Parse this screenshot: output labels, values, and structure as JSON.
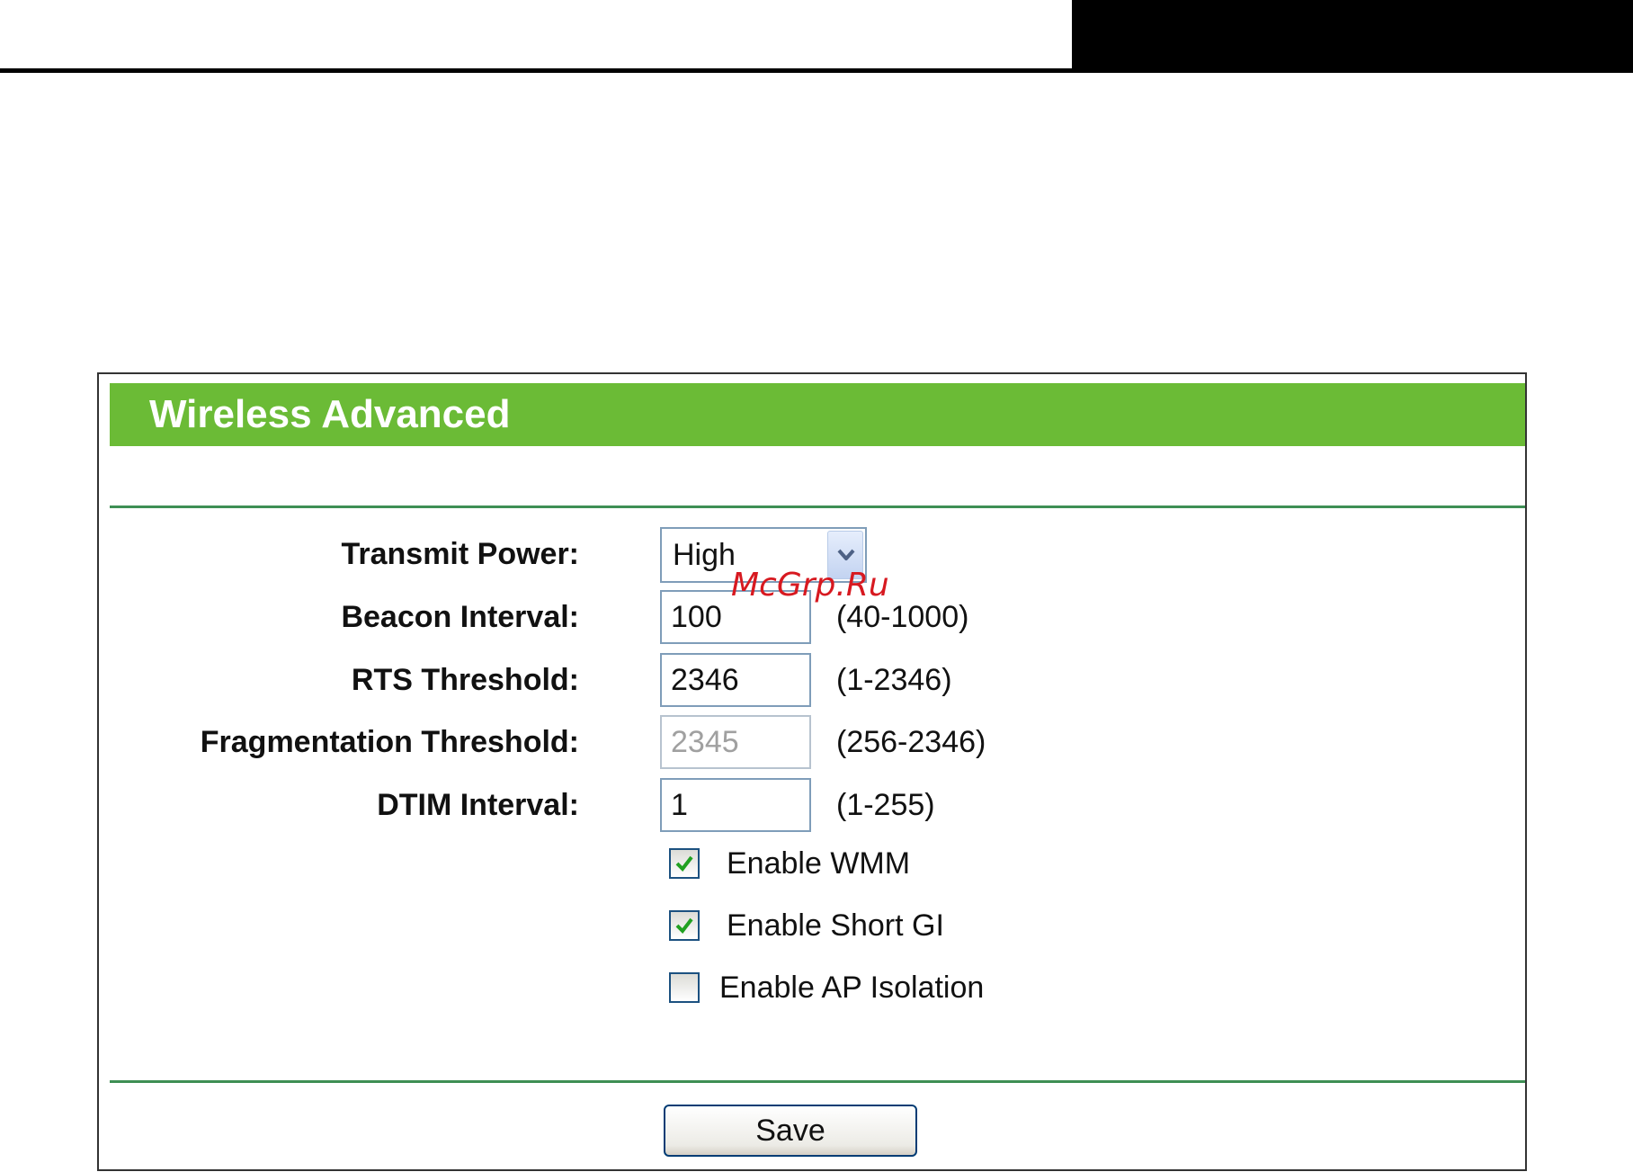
{
  "panel": {
    "title": "Wireless Advanced"
  },
  "transmit_power": {
    "label": "Transmit Power:",
    "selected": "High"
  },
  "beacon_interval": {
    "label": "Beacon Interval:",
    "value": "100",
    "range": "(40-1000)"
  },
  "rts_threshold": {
    "label": "RTS Threshold:",
    "value": "2346",
    "range": "(1-2346)"
  },
  "fragmentation_threshold": {
    "label": "Fragmentation Threshold:",
    "value": "2345",
    "range": "(256-2346)",
    "disabled": true
  },
  "dtim_interval": {
    "label": "DTIM Interval:",
    "value": "1",
    "range": "(1-255)"
  },
  "options": [
    {
      "label": "Enable WMM",
      "checked": true
    },
    {
      "label": "Enable Short GI",
      "checked": true
    },
    {
      "label": "Enable AP Isolation",
      "checked": false
    }
  ],
  "save_label": "Save",
  "watermark": "McGrp.Ru",
  "colors": {
    "title_bar": "#6bbb36",
    "divider": "#3e8f54",
    "check_mark": "#21a121",
    "watermark": "#d71920"
  },
  "icons": {
    "select_arrow": "chevron-down-icon",
    "check": "checkmark-icon"
  }
}
